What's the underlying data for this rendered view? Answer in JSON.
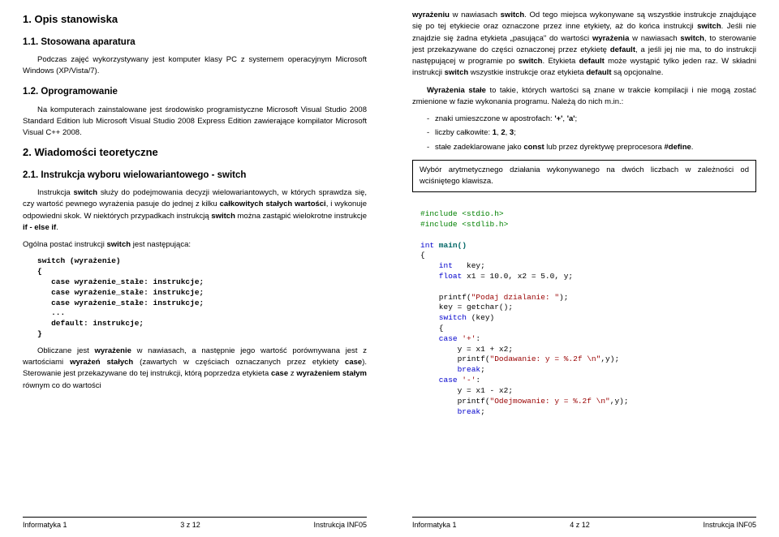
{
  "left": {
    "h1": "1. Opis stanowiska",
    "h2a": "1.1. Stosowana aparatura",
    "p1": "Podczas zajęć wykorzystywany jest komputer klasy PC z systemem operacyjnym Microsoft Windows (XP/Vista/7).",
    "h2b": "1.2. Oprogramowanie",
    "p2": "Na komputerach zainstalowane jest środowisko programistyczne Microsoft Visual Studio 2008 Standard Edition lub Microsoft Visual Studio 2008 Express Edition zawierające kompilator Microsoft Visual C++ 2008.",
    "h1b": "2. Wiadomości teoretyczne",
    "h2c": "2.1. Instrukcja wyboru wielowariantowego - switch",
    "p3a": "Instrukcja ",
    "p3b": "switch",
    "p3c": " służy do podejmowania decyzji wielowariantowych, w których sprawdza się, czy wartość pewnego wyrażenia pasuje do jednej z kilku ",
    "p3d": "całkowitych stałych wartości",
    "p3e": ", i wykonuje odpowiedni skok. W niektórych przypadkach instrukcją ",
    "p3f": "switch",
    "p3g": " można zastąpić wielokrotne instrukcje ",
    "p3h": "if - else if",
    "p3i": ".",
    "p4a": "Ogólna postać instrukcji ",
    "p4b": "switch",
    "p4c": " jest następująca:",
    "code1": "switch (wyrażenie)\n{\n   case wyrażenie_stałe: instrukcje;\n   case wyrażenie_stałe: instrukcje;\n   case wyrażenie_stałe: instrukcje;\n   ...\n   default: instrukcje;\n}",
    "p5a": "Obliczane jest ",
    "p5b": "wyrażenie",
    "p5c": " w nawiasach, a następnie jego wartość porównywana jest z wartościami ",
    "p5d": "wyrażeń stałych",
    "p5e": " (zawartych w częściach oznaczanych przez etykiety ",
    "p5f": "case",
    "p5g": "). Sterowanie jest przekazywane do tej instrukcji, którą poprzedza etykieta ",
    "p5h": "case",
    "p5i": " z ",
    "p5j": "wyrażeniem stałym",
    "p5k": " równym co do wartości",
    "footer": {
      "l": "Informatyka 1",
      "c": "3 z 12",
      "r": "Instrukcja INF05"
    }
  },
  "right": {
    "p1a": "wyrażeniu",
    "p1b": " w nawiasach ",
    "p1c": "switch",
    "p1d": ". Od tego miejsca wykonywane są wszystkie instrukcje znajdujące się po tej etykiecie oraz oznaczone przez inne etykiety, aż do końca instrukcji ",
    "p1e": "switch",
    "p1f": ". Jeśli nie znajdzie się żadna etykieta „pasująca\" do wartości ",
    "p1g": "wyrażenia",
    "p1h": " w nawiasach ",
    "p1i": "switch",
    "p1j": ", to sterowanie jest przekazywane do części oznaczonej przez etykietę ",
    "p1k": "default",
    "p1l": ", a jeśli jej nie ma, to do instrukcji następującej w programie po ",
    "p1m": "switch",
    "p1n": ". Etykieta ",
    "p1o": "default",
    "p1p": " może wystąpić tylko jeden raz. W składni instrukcji ",
    "p1q": "switch",
    "p1r": " wszystkie instrukcje oraz etykieta ",
    "p1s": "default",
    "p1t": " są opcjonalne.",
    "p2a": "Wyrażenia stałe",
    "p2b": " to takie, których wartości są znane w trakcie kompilacji i nie mogą zostać zmienione w fazie wykonania programu. Należą do nich m.in.:",
    "li1a": "znaki umieszczone w apostrofach: ",
    "li1b": "'+'",
    "li1c": ", ",
    "li1d": "'a'",
    "li1e": ";",
    "li2a": "liczby całkowite: ",
    "li2b": "1",
    "li2c": ", ",
    "li2d": "2",
    "li2e": ", ",
    "li2f": "3",
    "li2g": ";",
    "li3a": "stałe zadeklarowane jako ",
    "li3b": "const",
    "li3c": " lub przez dyrektywę preprocesora ",
    "li3d": "#define",
    "li3e": ".",
    "framed": "Wybór arytmetycznego działania wykonywanego na dwóch liczbach w zależności od wciśniętego klawisza.",
    "code2_l1": "#include <stdio.h>",
    "code2_l2": "#include <stdlib.h>",
    "code2_l3a": "int",
    "code2_l3b": " main()",
    "code2_l4": "{",
    "code2_l5a": "    int",
    "code2_l5b": "   key;",
    "code2_l6a": "    float",
    "code2_l6b": " x1 = 10.0, x2 = 5.0, y;",
    "code2_l7a": "    printf(",
    "code2_l7b": "\"Podaj dzialanie: \"",
    "code2_l7c": ");",
    "code2_l8": "    key = getchar();",
    "code2_l9a": "    switch",
    "code2_l9b": " (key)",
    "code2_l10": "    {",
    "code2_l11a": "    case",
    "code2_l11b": " '+'",
    "code2_l11c": ":",
    "code2_l12": "        y = x1 + x2;",
    "code2_l13a": "        printf(",
    "code2_l13b": "\"Dodawanie: y = %.2f \\n\"",
    "code2_l13c": ",y);",
    "code2_l14a": "        break",
    "code2_l14b": ";",
    "code2_l15a": "    case",
    "code2_l15b": " '-'",
    "code2_l15c": ":",
    "code2_l16": "        y = x1 - x2;",
    "code2_l17a": "        printf(",
    "code2_l17b": "\"Odejmowanie: y = %.2f \\n\"",
    "code2_l17c": ",y);",
    "code2_l18a": "        break",
    "code2_l18b": ";",
    "footer": {
      "l": "Informatyka 1",
      "c": "4 z 12",
      "r": "Instrukcja INF05"
    }
  }
}
